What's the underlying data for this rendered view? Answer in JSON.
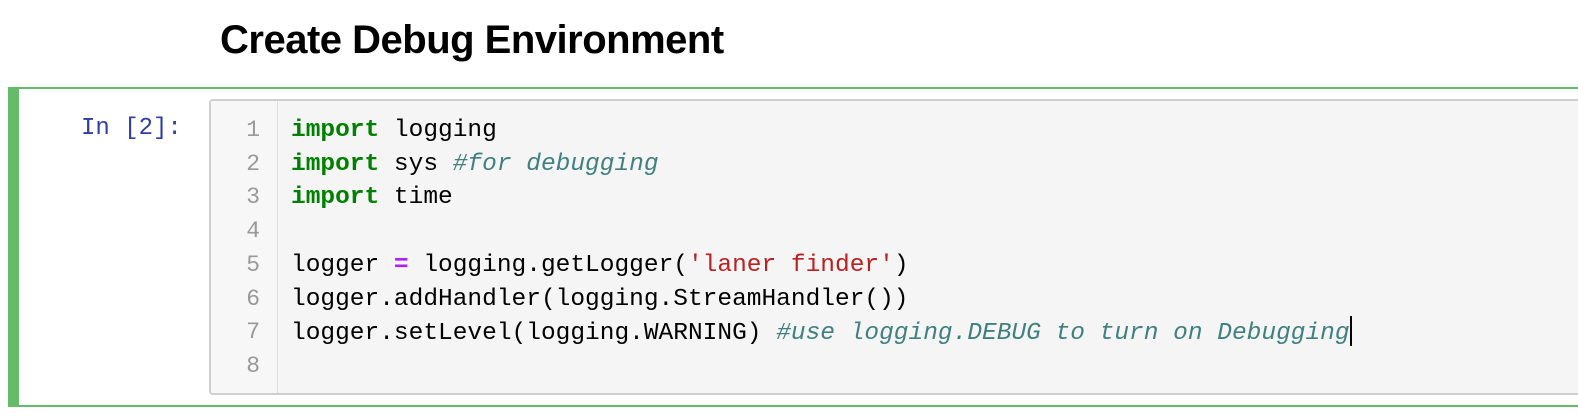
{
  "heading": "Create Debug Environment",
  "cell": {
    "prompt": "In [2]:",
    "line_numbers": [
      "1",
      "2",
      "3",
      "4",
      "5",
      "6",
      "7",
      "8"
    ],
    "code": [
      [
        {
          "t": "kw",
          "v": "import"
        },
        {
          "t": "plain",
          "v": " logging"
        }
      ],
      [
        {
          "t": "kw",
          "v": "import"
        },
        {
          "t": "plain",
          "v": " sys "
        },
        {
          "t": "cm",
          "v": "#for debugging"
        }
      ],
      [
        {
          "t": "kw",
          "v": "import"
        },
        {
          "t": "plain",
          "v": " time"
        }
      ],
      [],
      [
        {
          "t": "plain",
          "v": "logger "
        },
        {
          "t": "op",
          "v": "="
        },
        {
          "t": "plain",
          "v": " logging.getLogger("
        },
        {
          "t": "st",
          "v": "'laner finder'"
        },
        {
          "t": "plain",
          "v": ")"
        }
      ],
      [
        {
          "t": "plain",
          "v": "logger.addHandler(logging.StreamHandler())"
        }
      ],
      [
        {
          "t": "plain",
          "v": "logger.setLevel(logging.WARNING) "
        },
        {
          "t": "cm",
          "v": "#use logging.DEBUG to turn on Debugging"
        },
        {
          "t": "cursor",
          "v": ""
        }
      ],
      []
    ]
  },
  "colors": {
    "cell_border_selected": "#66bb6a",
    "prompt": "#303f9f",
    "keyword": "#008000",
    "comment": "#408080",
    "operator": "#aa22ff",
    "string": "#ba2121"
  }
}
